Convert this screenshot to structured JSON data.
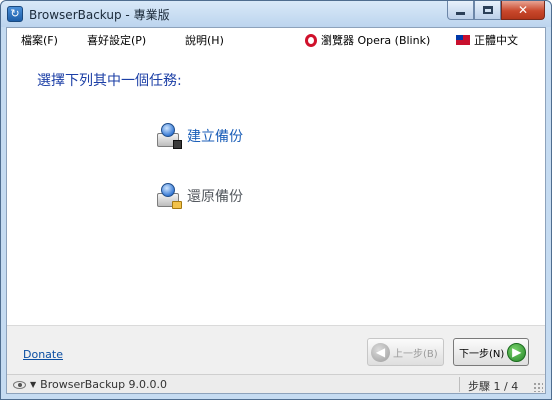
{
  "window": {
    "title": "BrowserBackup - 專業版",
    "icon": "browserbackup-app-icon"
  },
  "menu": {
    "file": "檔案(F)",
    "preferences": "喜好設定(P)",
    "help": "說明(H)",
    "browser_indicator": "瀏覽器 Opera (Blink)",
    "browser_icon": "opera-icon",
    "language_indicator": "正體中文",
    "language_icon": "taiwan-flag-icon"
  },
  "main": {
    "prompt": "選擇下列其中一個任務:",
    "tasks": [
      {
        "label": "建立備份",
        "icon": "create-backup-icon",
        "enabled": true
      },
      {
        "label": "還原備份",
        "icon": "restore-backup-icon",
        "enabled": true
      }
    ]
  },
  "footer": {
    "donate": "Donate",
    "prev_label": "上一步(B)",
    "prev_enabled": false,
    "next_label": "下一步(N)",
    "next_enabled": true
  },
  "status": {
    "version": "BrowserBackup 9.0.0.0",
    "step": "步驟 1 / 4"
  },
  "colors": {
    "link_blue": "#1c5fb8",
    "prompt_blue": "#1c3fa6",
    "opera_red": "#d0112b",
    "next_green": "#27862a"
  }
}
